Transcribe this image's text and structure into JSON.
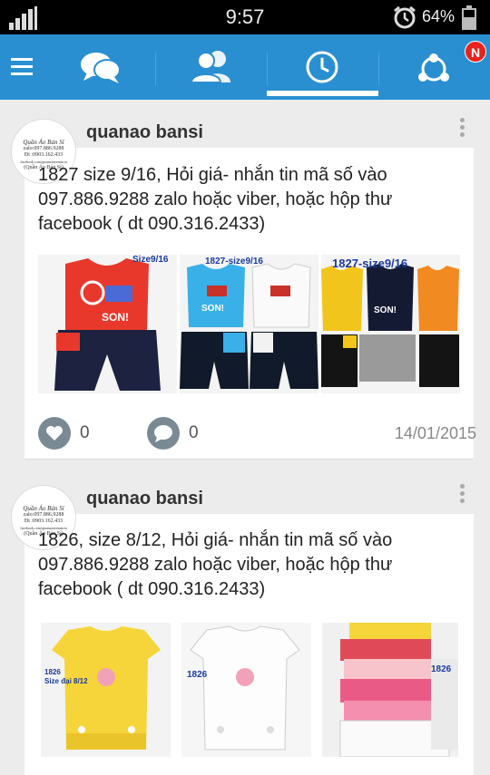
{
  "status_bar": {
    "time": "9:57",
    "battery": "64%"
  },
  "nav": {
    "badge": "N"
  },
  "posts": [
    {
      "author": "quanao bansi",
      "text": "1827 size 9/16, Hỏi giá-  nhắn tin mã số vào\n097.886.9288 zalo hoặc viber, hoặc hộp thư\nfacebook ( dt 090.316.2433)",
      "photos": [
        {
          "label": "Size9/16",
          "shirt_text": "SON!"
        },
        {
          "label": "1827-size9/16",
          "shirt_text": "SON!"
        },
        {
          "label": "1827-size9/16",
          "shirt_text": "SON!"
        }
      ],
      "likes": "0",
      "comments": "0",
      "date": "14/01/2015"
    },
    {
      "author": "quanao bansi",
      "text": "1826, size 8/12, Hỏi giá-  nhắn tin mã số vào\n097.886.9288 zalo hoặc viber, hoặc hộp thư\nfacebook ( dt 090.316.2433)",
      "photos": [
        {
          "label": "1826",
          "sublabel": "Size đại 8/12"
        },
        {
          "label": "1826"
        },
        {
          "label": "1826"
        }
      ]
    }
  ],
  "avatar_logo": {
    "title": "Quần Áo Bán Sỉ",
    "line1": "zalo:097.886.9288",
    "line2": "Đt :0903.162.433",
    "line3": "facebook.com/quanaotreemsiria",
    "line4": "(Quần Áo Bán Sỉ)"
  },
  "colors": {
    "nav_bg": "#2a8fd1",
    "badge": "#e8231f",
    "page_bg": "#ececec"
  },
  "icons": [
    "signal-icon",
    "alarm-icon",
    "battery-icon",
    "menu-icon",
    "chat-icon",
    "friends-icon",
    "clock-icon",
    "share-icon",
    "heart-icon",
    "comment-icon"
  ]
}
